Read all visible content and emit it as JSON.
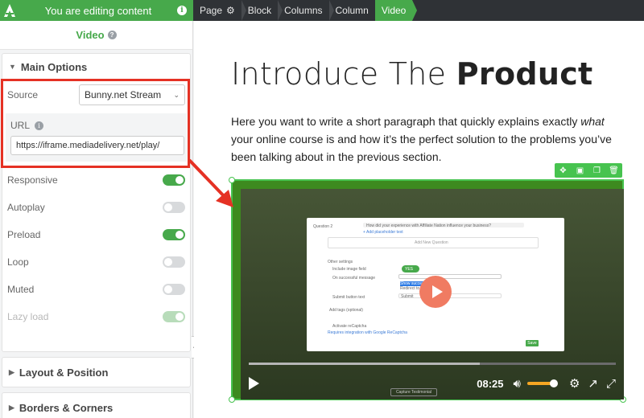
{
  "topbar": {
    "editing_label": "You are editing content",
    "breadcrumbs": [
      "Page",
      "Block",
      "Columns",
      "Column",
      "Video"
    ]
  },
  "sidebar": {
    "title": "Video",
    "main_options": {
      "heading": "Main Options",
      "source_label": "Source",
      "source_value": "Bunny.net Stream",
      "url_label": "URL",
      "url_value": "https://iframe.mediadelivery.net/play/"
    },
    "toggles": [
      {
        "label": "Responsive",
        "on": true
      },
      {
        "label": "Autoplay",
        "on": false
      },
      {
        "label": "Preload",
        "on": true
      },
      {
        "label": "Loop",
        "on": false
      },
      {
        "label": "Muted",
        "on": false
      },
      {
        "label": "Lazy load",
        "on": true,
        "disabled": true
      }
    ],
    "panels": [
      "Layout & Position",
      "Borders & Corners"
    ]
  },
  "content": {
    "heading_light": "Introduce The ",
    "heading_bold": "Product",
    "para_before": "Here you want to write a short paragraph that quickly explains exactly ",
    "para_em": "what",
    "para_after": " your online course is and how it’s the perfect solution to the problems you’ve been talking about in the previous section.",
    "video": {
      "time": "08:25",
      "progress": 0.63,
      "modal_question": "Question 2",
      "modal_prompt": "How did your experience with Affiliate Nation influence your business?",
      "modal_add_placeholder": "+ Add placeholder text",
      "modal_add_question": "Add New Question",
      "modal_other": "Other settings",
      "modal_include_image": "Include image field",
      "modal_on_success": "On successful message",
      "modal_yes": "YES",
      "modal_show_success": "Show success message",
      "modal_redirect": "Redirect to URL",
      "modal_submit_label": "Submit button text",
      "modal_submit": "Submit",
      "modal_tags": "Add tags (optional)",
      "modal_recaptcha": "Activate reCaptcha",
      "modal_recaptcha_note": "Requires integration with Google ReCaptcha",
      "modal_save": "Save",
      "capture_label": "Capture Testimonial"
    }
  },
  "colors": {
    "brand_green": "#47a94b",
    "highlight_red": "#e53124",
    "dark_bar": "#2f3236"
  }
}
